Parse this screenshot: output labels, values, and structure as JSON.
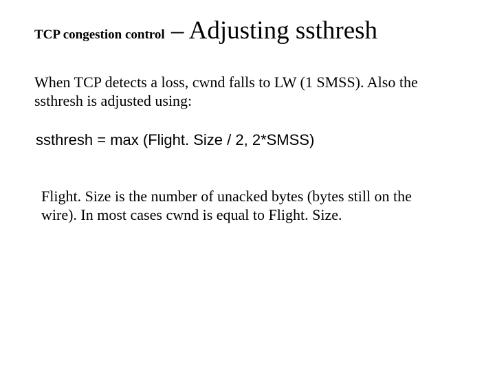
{
  "title": {
    "sub": "TCP congestion control",
    "main": " – Adjusting ssthresh"
  },
  "body": {
    "para1": "When TCP detects a loss, cwnd falls to LW (1 SMSS). Also the ssthresh is adjusted using:",
    "formula": "ssthresh = max (Flight. Size / 2, 2*SMSS)",
    "para2": "Flight. Size is the number of unacked bytes (bytes still on the wire).  In most cases cwnd is equal to Flight. Size."
  }
}
